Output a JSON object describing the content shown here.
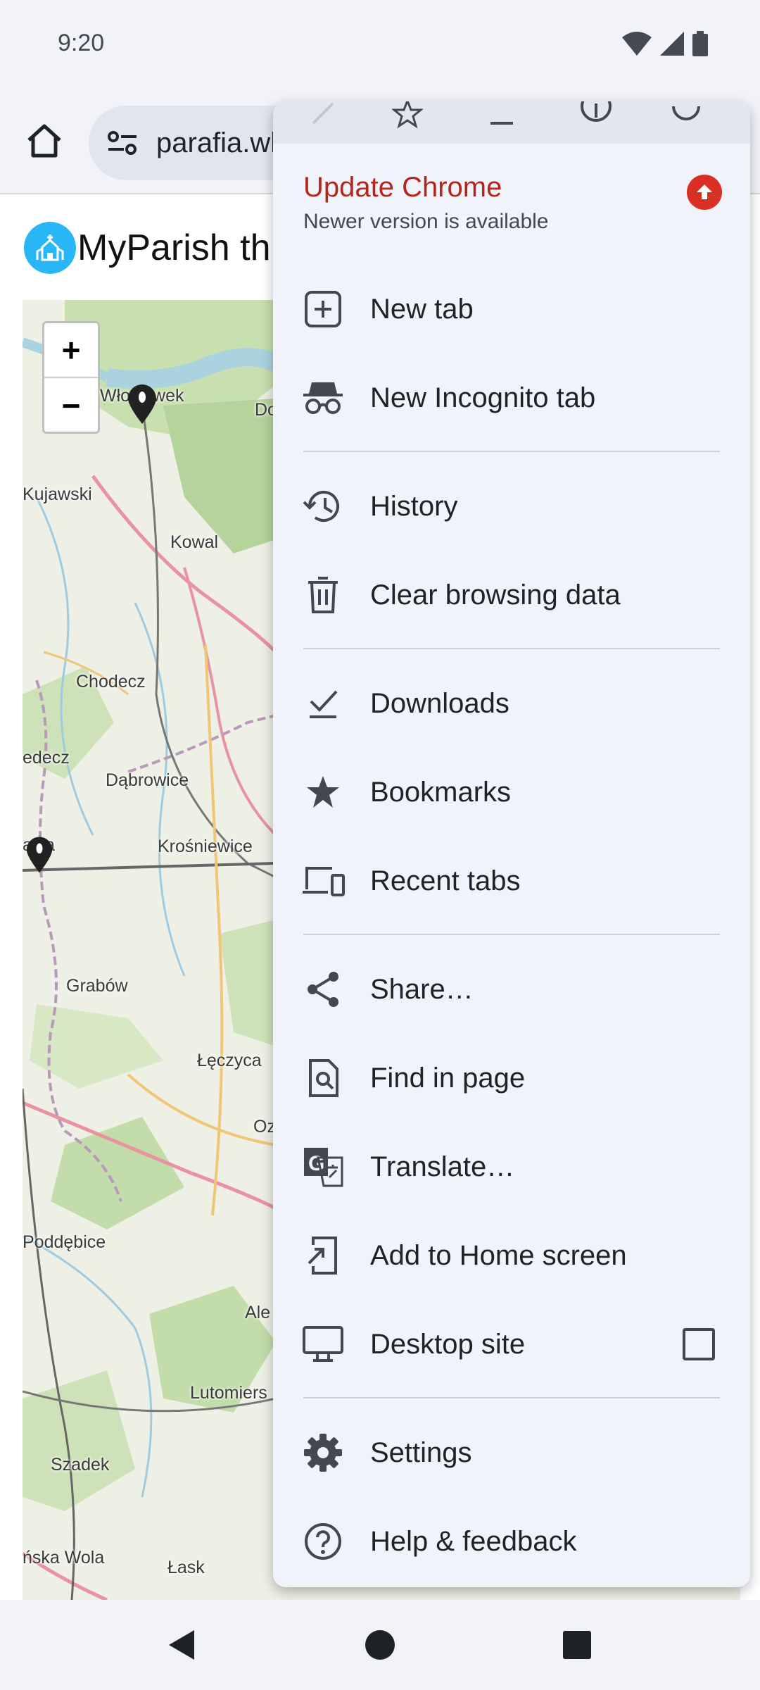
{
  "status_bar": {
    "time": "9:20"
  },
  "toolbar": {
    "url": "parafia.wl"
  },
  "page": {
    "site_title": "MyParish th",
    "zoom_in": "+",
    "zoom_out": "−",
    "map_labels": [
      "Włocławek",
      "Kujawski",
      "Kowal",
      "Chodecz",
      "edecz",
      "Dąbrowice",
      "awa",
      "Krośniewice",
      "Grabów",
      "Łęczyca",
      "Oz",
      "Poddębice",
      "Ale",
      "Lutomiers",
      "Szadek",
      "ńska Wola",
      "Łask",
      "Do"
    ]
  },
  "menu": {
    "update_title": "Update Chrome",
    "update_subtitle": "Newer version is available",
    "items": [
      {
        "label": "New tab",
        "icon": "plus-box-icon"
      },
      {
        "label": "New Incognito tab",
        "icon": "incognito-icon"
      },
      {
        "label": "History",
        "icon": "history-icon"
      },
      {
        "label": "Clear browsing data",
        "icon": "trash-icon"
      },
      {
        "label": "Downloads",
        "icon": "download-done-icon"
      },
      {
        "label": "Bookmarks",
        "icon": "star-icon"
      },
      {
        "label": "Recent tabs",
        "icon": "devices-icon"
      },
      {
        "label": "Share…",
        "icon": "share-icon"
      },
      {
        "label": "Find in page",
        "icon": "find-in-page-icon"
      },
      {
        "label": "Translate…",
        "icon": "translate-icon"
      },
      {
        "label": "Add to Home screen",
        "icon": "add-to-home-icon"
      },
      {
        "label": "Desktop site",
        "icon": "desktop-icon",
        "checkbox": false
      },
      {
        "label": "Settings",
        "icon": "gear-icon"
      },
      {
        "label": "Help & feedback",
        "icon": "help-icon"
      }
    ]
  },
  "colors": {
    "update_red": "#b3261e",
    "menu_bg": "#f1f3fa",
    "chrome_bg": "#f1f3f9"
  }
}
